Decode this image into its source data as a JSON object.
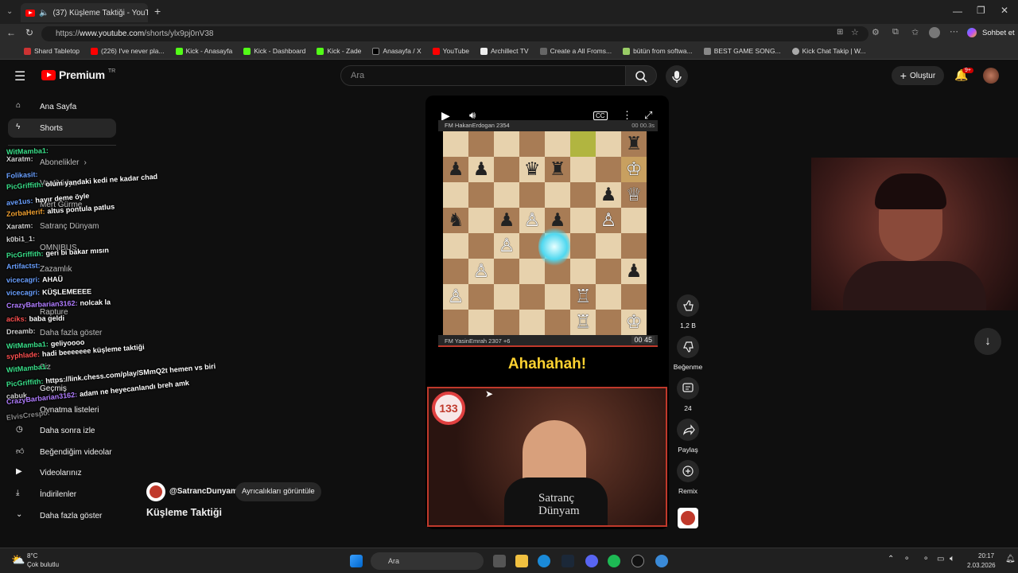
{
  "browser": {
    "tab_title": "(37) Küşleme Taktiği - YouTub",
    "url_prefix": "https://",
    "url_host": "www.youtube.com",
    "url_path": "/shorts/ylx9pj0nV38",
    "copilot_label": "Sohbet et",
    "bookmarks": [
      "Shard Tabletop",
      "(226) I've never pla...",
      "Kick - Anasayfa",
      "Kick - Dashboard",
      "Kick - Zade",
      "Anasayfa / X",
      "YouTube",
      "Archillect TV",
      "Create a All Froms...",
      "bütün from softwa...",
      "BEST GAME SONG...",
      "Kick Chat Takip | W..."
    ]
  },
  "youtube": {
    "logo_text": "Premium",
    "logo_region": "TR",
    "search_placeholder": "Ara",
    "create_label": "Oluştur",
    "notif_count": "9+"
  },
  "sidebar": {
    "items": [
      "Ana Sayfa",
      "Shorts",
      "Abonelikler",
      "VaatiVidya",
      "Mert Gürme",
      "Satranç Dünyam",
      "OMNIBUS",
      "Zazamlık",
      "Rapture",
      "Daha fazla göster",
      "Siz",
      "Geçmiş",
      "Oynatma listeleri",
      "Daha sonra izle",
      "Beğendiğim videolar",
      "Videolarınız",
      "İndirilenler",
      "Daha fazla göster"
    ]
  },
  "chat": [
    {
      "user": "WitMamba1:",
      "msg": "",
      "color": "#3ae08a"
    },
    {
      "user": "Xaratm:",
      "msg": "",
      "color": "#d0d0d0"
    },
    {
      "user": "Folikasit:",
      "msg": "",
      "color": "#6aa0ff"
    },
    {
      "user": "PicGriffith:",
      "msg": "olum yandaki kedi ne kadar chad",
      "color": "#3ae08a"
    },
    {
      "user": "ave1us:",
      "msg": "hayır deme öyle",
      "color": "#6aa0ff"
    },
    {
      "user": "ZorbaHerif:",
      "msg": "altus pontula patlus",
      "color": "#f0a030"
    },
    {
      "user": "Xaratm:",
      "msg": "",
      "color": "#d0d0d0"
    },
    {
      "user": "k0bi1_1:",
      "msg": "",
      "color": "#d0d0d0"
    },
    {
      "user": "PicGriffith:",
      "msg": "geri bi bakar mısın",
      "color": "#3ae08a"
    },
    {
      "user": "Artifactst:",
      "msg": "",
      "color": "#6aa0ff"
    },
    {
      "user": "vicecagri:",
      "msg": "AHAÜ",
      "color": "#6aa0ff"
    },
    {
      "user": "vicecagri:",
      "msg": "KÜŞLEMEEEE",
      "color": "#6aa0ff"
    },
    {
      "user": "CrazyBarbarian3162:",
      "msg": "nolcak la",
      "color": "#b07cff"
    },
    {
      "user": "acíks:",
      "msg": "baba geldi",
      "color": "#ff5050"
    },
    {
      "user": "Dreamb:",
      "msg": "",
      "color": "#d0d0d0"
    },
    {
      "user": "WitMamba1:",
      "msg": "geliyoooo",
      "color": "#3ae08a"
    },
    {
      "user": "syphlade:",
      "msg": "hadi beeeeeee küşleme taktiği",
      "color": "#ff5050"
    },
    {
      "user": "WitMamba1:",
      "msg": "",
      "color": "#3ae08a"
    },
    {
      "user": "PicGriffith:",
      "msg": "https://link.chess.com/play/SMmQ2t hemen vs biri",
      "color": "#3ae08a"
    },
    {
      "user": "çabuk",
      "msg": "",
      "color": "#d0d0d0"
    },
    {
      "user": "CrazyBarbarian3162:",
      "msg": "adam ne heyecanlandı breh amk",
      "color": "#b07cff"
    },
    {
      "user": "ElvisCrespo:",
      "msg": "",
      "color": "#888888"
    }
  ],
  "short": {
    "top_player": "FM HakanErdogan 2354",
    "top_clock": "00 00.3s",
    "bottom_player": "FM YasinEmrah 2307 +6",
    "bottom_clock": "00 45",
    "caption": "Ahahahah!",
    "heart_count": "133",
    "brand_line1": "Satranç",
    "brand_line2": "Dünyam",
    "channel": "@SatrancDunyam",
    "perks_label": "Ayrıcalıkları görüntüle",
    "title": "Küşleme Taktiği"
  },
  "board": [
    [
      "",
      "",
      "",
      "",
      "",
      "hl",
      "",
      "bR"
    ],
    [
      "bP",
      "bP",
      "",
      "bQ",
      "bR",
      "",
      "",
      "wK*"
    ],
    [
      "",
      "",
      "",
      "",
      "",
      "",
      "bP",
      "wQ"
    ],
    [
      "bN",
      "",
      "bP",
      "wP",
      "bP",
      "",
      "wP",
      ""
    ],
    [
      "",
      "",
      "wP",
      "",
      "",
      "",
      "",
      ""
    ],
    [
      "",
      "wP",
      "",
      "",
      "",
      "",
      "",
      "bP"
    ],
    [
      "wP",
      "",
      "",
      "",
      "",
      "wR",
      "",
      ""
    ],
    [
      "",
      "",
      "",
      "",
      "",
      "wR",
      "",
      "wK"
    ]
  ],
  "actions": {
    "like_count": "1,2 B",
    "dislike_label": "Beğenme",
    "comment_count": "24",
    "share_label": "Paylaş",
    "remix_label": "Remix"
  },
  "taskbar": {
    "temp": "8°C",
    "weather": "Çok bulutlu",
    "search": "Ara",
    "time": "20:17",
    "date": "2.03.2026"
  }
}
